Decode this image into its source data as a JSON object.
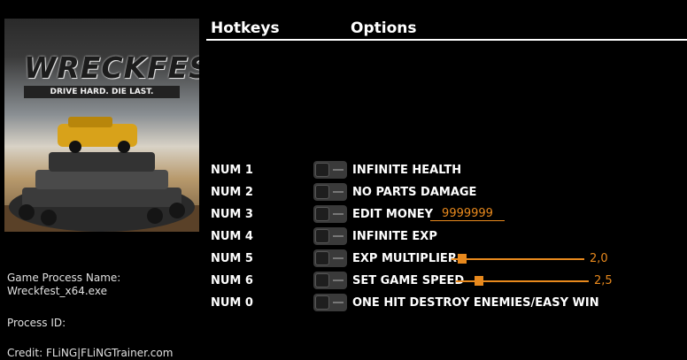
{
  "cover": {
    "title": "WRECKFEST",
    "tagline": "DRIVE HARD. DIE LAST."
  },
  "info": {
    "process_name_label": "Game Process Name:",
    "process_name": "Wreckfest_x64.exe",
    "process_id_label": "Process ID:",
    "credit": "Credit: FLiNG|FLiNGTrainer.com"
  },
  "headers": {
    "hotkeys": "Hotkeys",
    "options": "Options"
  },
  "colors": {
    "accent": "#e8891d",
    "background": "#000000"
  },
  "options": [
    {
      "hotkey": "NUM 1",
      "label": "INFINITE HEALTH",
      "enabled": false
    },
    {
      "hotkey": "NUM 2",
      "label": "NO PARTS DAMAGE",
      "enabled": false
    },
    {
      "hotkey": "NUM 3",
      "label": "EDIT MONEY",
      "enabled": false,
      "value": "9999999"
    },
    {
      "hotkey": "NUM 4",
      "label": "INFINITE EXP",
      "enabled": false
    },
    {
      "hotkey": "NUM 5",
      "label": "EXP MULTIPLIER",
      "enabled": false,
      "value": "2,0",
      "level": 0.08
    },
    {
      "hotkey": "NUM 6",
      "label": "SET GAME SPEED",
      "enabled": false,
      "value": "2,5",
      "level": 0.17
    },
    {
      "hotkey": "NUM 0",
      "label": "ONE HIT DESTROY ENEMIES/EASY WIN",
      "enabled": false
    }
  ]
}
